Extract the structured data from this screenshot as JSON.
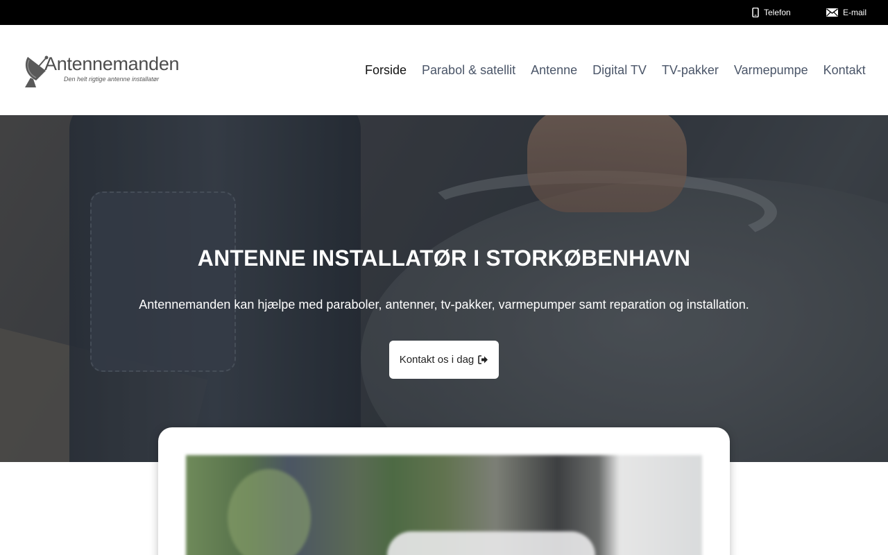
{
  "topbar": {
    "phone_label": "Telefon",
    "email_label": "E-mail"
  },
  "header": {
    "logo_name": "Antennemanden",
    "logo_tagline": "Den helt rigtige antenne installatør"
  },
  "nav": {
    "items": [
      {
        "label": "Forside",
        "active": true
      },
      {
        "label": "Parabol & satellit"
      },
      {
        "label": "Antenne"
      },
      {
        "label": "Digital TV"
      },
      {
        "label": "TV-pakker"
      },
      {
        "label": "Varmepumpe"
      },
      {
        "label": "Kontakt"
      }
    ]
  },
  "hero": {
    "title": "ANTENNE INSTALLATØR I STORKØBENHAVN",
    "subtitle": "Antennemanden kan hjælpe med paraboler, antenner, tv-pakker, varmepumper samt reparation og installation.",
    "cta_label": "Kontakt os i dag",
    "cta_icon": "sign-out-icon"
  },
  "colors": {
    "topbar_bg": "#000000",
    "nav_text": "#4a5568",
    "nav_active": "#111111",
    "hero_text": "#ffffff"
  }
}
